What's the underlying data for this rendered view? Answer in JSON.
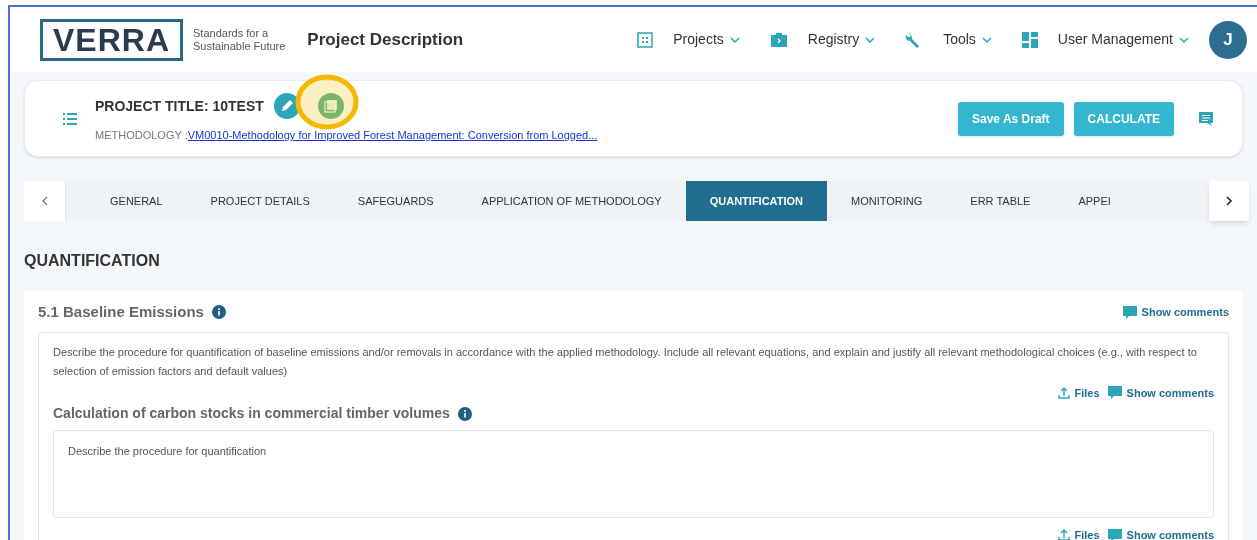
{
  "header": {
    "logo": "VERRA",
    "tagline": [
      "Standards for a",
      "Sustainable Future"
    ],
    "title": "Project Description",
    "nav": [
      {
        "kind": "grid",
        "label": "Projects"
      },
      {
        "kind": "briefcase",
        "label": "Registry"
      },
      {
        "kind": "wrench",
        "label": "Tools"
      },
      {
        "kind": "dashboard",
        "label": "User Management"
      }
    ],
    "avatar": "J"
  },
  "project": {
    "title": "PROJECT TITLE: 10TEST",
    "methodology_label": "METHODOLOGY :",
    "methodology": "VM0010-Methodology for Improved Forest Management: Conversion from Logged...",
    "pdf_highlighted": true,
    "buttons": [
      "Save As Draft",
      "CALCULATE"
    ]
  },
  "tabs": [
    {
      "label": "GENERAL",
      "selected": false
    },
    {
      "label": "PROJECT DETAILS",
      "selected": false
    },
    {
      "label": "SAFEGUARDS",
      "selected": false
    },
    {
      "label": "APPLICATION OF METHODOLOGY",
      "selected": false
    },
    {
      "label": "QUANTIFICATION",
      "selected": true
    },
    {
      "label": "MONITORING",
      "selected": false
    },
    {
      "label": "ERR TABLE",
      "selected": false
    },
    {
      "label": "APPEI",
      "selected": false
    }
  ],
  "page_heading": "QUANTIFICATION",
  "section": {
    "title": "5.1  Baseline Emissions",
    "show_comments": "Show comments",
    "description": "Describe the procedure for quantification of baseline emissions and/or removals in accordance with the applied methodology. Include all relevant equations, and explain and justify all relevant methodological choices (e.g., with respect to selection of emission factors and default values)",
    "files": "Files",
    "show_comments_2": "Show comments",
    "subsection": "Calculation of carbon stocks in commercial timber volumes",
    "placeholder": "Describe the procedure for quantification",
    "files_2": "Files",
    "show_comments_3": "Show comments"
  }
}
